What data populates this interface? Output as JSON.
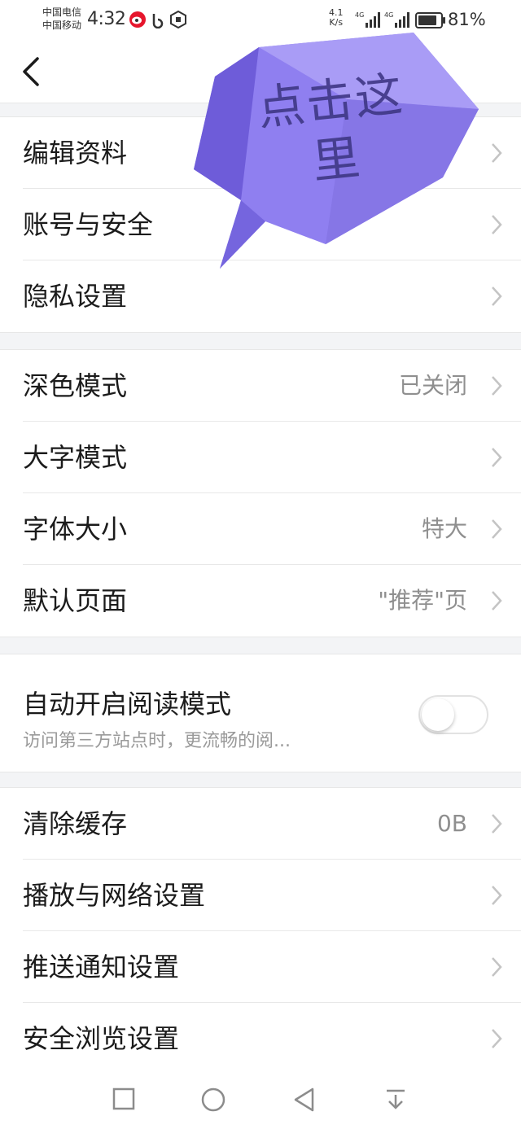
{
  "status_bar": {
    "carrier_1": "中国电信",
    "carrier_2": "中国移动",
    "time": "4:32",
    "net_speed_value": "4.1",
    "net_speed_unit": "K/s",
    "network_label": "4G",
    "battery_percent": "81%"
  },
  "nav": {
    "back_icon": "chevron-left-icon",
    "title": ""
  },
  "section_account": [
    {
      "label": "编辑资料",
      "value": ""
    },
    {
      "label": "账号与安全",
      "value": ""
    },
    {
      "label": "隐私设置",
      "value": ""
    }
  ],
  "section_display": [
    {
      "label": "深色模式",
      "value": "已关闭"
    },
    {
      "label": "大字模式",
      "value": ""
    },
    {
      "label": "字体大小",
      "value": "特大"
    },
    {
      "label": "默认页面",
      "value": "\"推荐\"页"
    }
  ],
  "reading_mode": {
    "title": "自动开启阅读模式",
    "subtitle": "访问第三方站点时，更流畅的阅...",
    "enabled": false
  },
  "section_other": [
    {
      "label": "清除缓存",
      "value": "0B"
    },
    {
      "label": "播放与网络设置",
      "value": ""
    },
    {
      "label": "推送通知设置",
      "value": ""
    },
    {
      "label": "安全浏览设置",
      "value": ""
    }
  ],
  "overlay": {
    "text_line1": "点击这",
    "text_line2": "里",
    "color": "#9b8cf2"
  },
  "system_nav": [
    "square-recent-icon",
    "circle-home-icon",
    "triangle-back-icon",
    "pull-down-icon"
  ]
}
